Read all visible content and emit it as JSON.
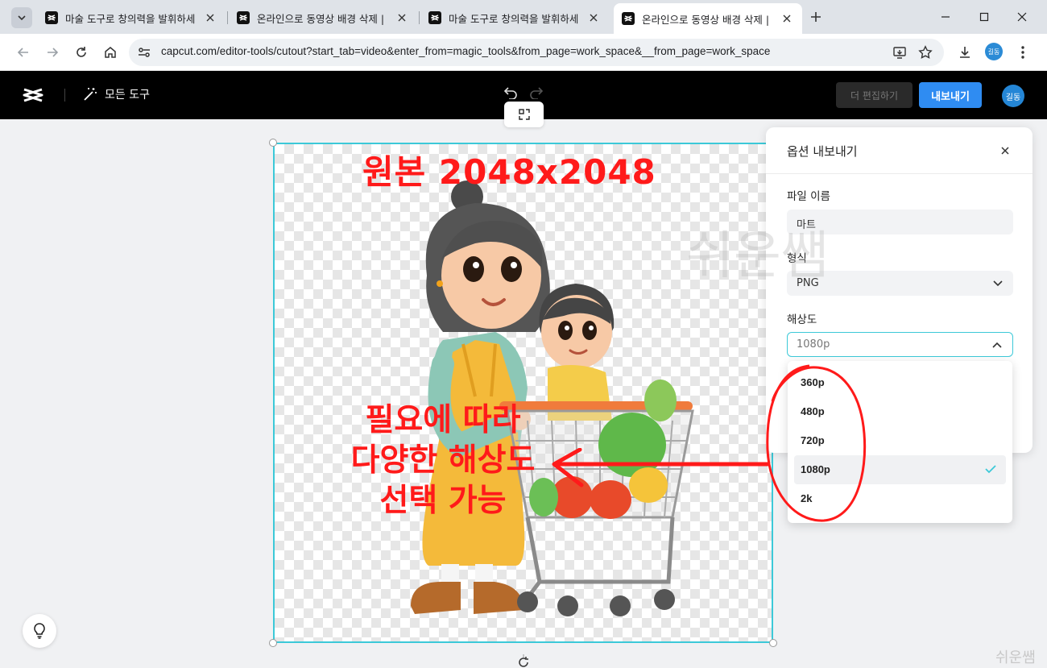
{
  "browser": {
    "tabs": [
      {
        "title": "마술 도구로 창의력을 발휘하세",
        "active": false
      },
      {
        "title": "온라인으로 동영상 배경 삭제 |",
        "active": false
      },
      {
        "title": "마술 도구로 창의력을 발휘하세",
        "active": false
      },
      {
        "title": "온라인으로 동영상 배경 삭제 |",
        "active": true
      }
    ],
    "url": "capcut.com/editor-tools/cutout?start_tab=video&enter_from=magic_tools&from_page=work_space&__from_page=work_space",
    "profile_initials": "길동"
  },
  "app": {
    "all_tools_label": "모든 도구",
    "edit_more_label": "더 편집하기",
    "export_label": "내보내기",
    "avatar_initials": "길동",
    "accent_color": "#2f8cf2",
    "selection_color": "#3cc9d8"
  },
  "annotations": {
    "title": "원본 2048x2048",
    "body_lines": [
      "필요에 따라",
      "다양한 해상도",
      "선택 가능"
    ],
    "watermark": "쉬운쌤",
    "watermark_small": "쉬운쌤",
    "color": "#ff1a1a"
  },
  "export_panel": {
    "title": "옵션 내보내기",
    "file_name_label": "파일 이름",
    "file_name_value": "마트",
    "format_label": "형식",
    "format_value": "PNG",
    "resolution_label": "해상도",
    "resolution_value": "1080p",
    "resolution_options": [
      "360p",
      "480p",
      "720p",
      "1080p",
      "2k"
    ],
    "selected_option": "1080p"
  }
}
